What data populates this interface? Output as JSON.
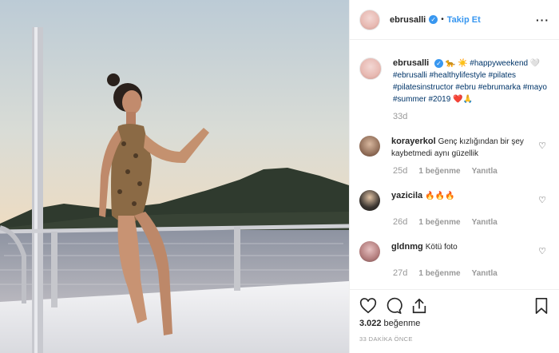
{
  "post": {
    "username": "ebrusalli",
    "follow_label": "Takip Et",
    "caption_parts": [
      {
        "text": "🐆 ☀️ ",
        "tag": false
      },
      {
        "text": "#happyweekend",
        "tag": true
      },
      {
        "text": " 🤍 ",
        "tag": false
      },
      {
        "text": "#ebrusalli",
        "tag": true
      },
      {
        "text": " ",
        "tag": false
      },
      {
        "text": "#healthylifestyle",
        "tag": true
      },
      {
        "text": " ",
        "tag": false
      },
      {
        "text": "#pilates",
        "tag": true
      },
      {
        "text": " ",
        "tag": false
      },
      {
        "text": "#pilatesinstructor",
        "tag": true
      },
      {
        "text": " ",
        "tag": false
      },
      {
        "text": "#ebru",
        "tag": true
      },
      {
        "text": " ",
        "tag": false
      },
      {
        "text": "#ebrumarka",
        "tag": true
      },
      {
        "text": " ",
        "tag": false
      },
      {
        "text": "#mayo",
        "tag": true
      },
      {
        "text": " ",
        "tag": false
      },
      {
        "text": "#summer",
        "tag": true
      },
      {
        "text": " ",
        "tag": false
      },
      {
        "text": "#2019",
        "tag": true
      },
      {
        "text": " ❤️🙏",
        "tag": false
      }
    ],
    "caption_age": "33d",
    "likes_count": "3.022",
    "likes_word": "beğenme",
    "time_ago": "33 DAKİKA ÖNCE"
  },
  "comments": [
    {
      "user": "korayerkol",
      "text": "Genç kızlığından bir şey kaybetmedi aynı güzellik",
      "age": "25d",
      "likes": "1 beğenme",
      "reply": "Yanıtla"
    },
    {
      "user": "yazicila",
      "text": "🔥🔥🔥",
      "age": "26d",
      "likes": "1 beğenme",
      "reply": "Yanıtla"
    },
    {
      "user": "gldnmg",
      "text": "Kötü foto",
      "age": "27d",
      "likes": "1 beğenme",
      "reply": "Yanıtla"
    }
  ],
  "icons": {
    "more": "more-options-icon",
    "verified": "verified-badge-icon",
    "heart": "heart-icon",
    "comment": "comment-icon",
    "share": "share-icon",
    "save": "bookmark-icon"
  },
  "colors": {
    "accent": "#3897f0",
    "hashtag": "#003569",
    "muted": "#999999"
  }
}
